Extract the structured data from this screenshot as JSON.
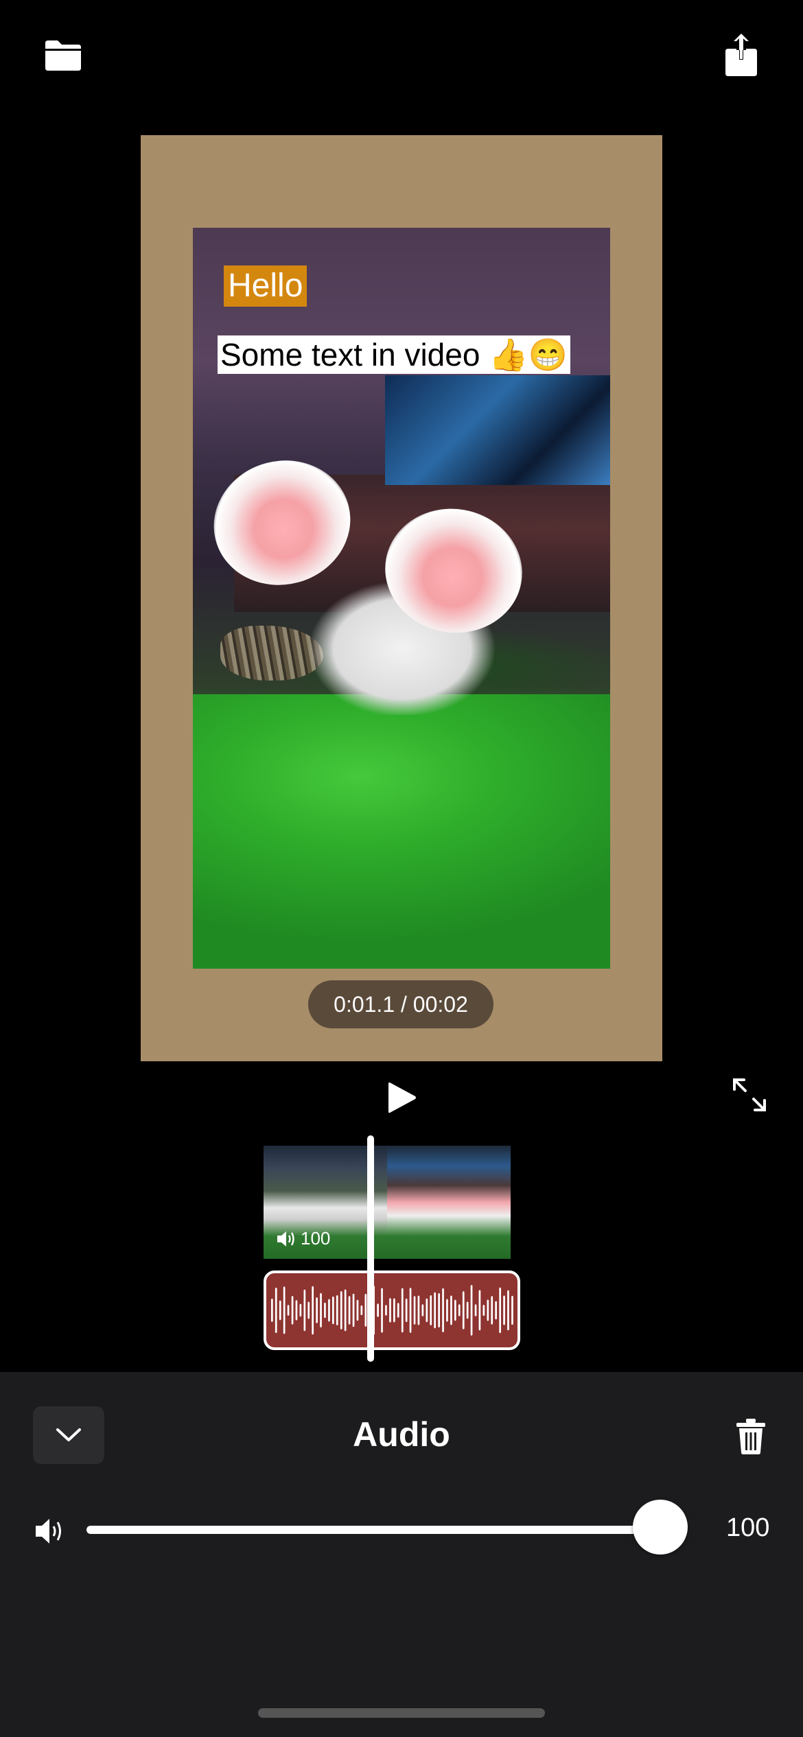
{
  "video": {
    "overlay_text_1": "Hello",
    "overlay_text_2": "Some text in video 👍😁",
    "timecode": "0:01.1 / 00:02"
  },
  "timeline": {
    "clip_volume": "100"
  },
  "panel": {
    "title": "Audio",
    "volume_value": "100",
    "volume_level": 1.0
  },
  "colors": {
    "canvas_background": "#a78d68",
    "audio_track": "#8e3431",
    "text_highlight": "#d4870f",
    "panel_background": "#1c1c1e"
  },
  "icons": {
    "top_left": "folder-icon",
    "top_right": "share-icon",
    "play": "play-icon",
    "expand": "expand-icon",
    "collapse": "chevron-down-icon",
    "delete": "trash-icon",
    "volume": "speaker-icon"
  }
}
